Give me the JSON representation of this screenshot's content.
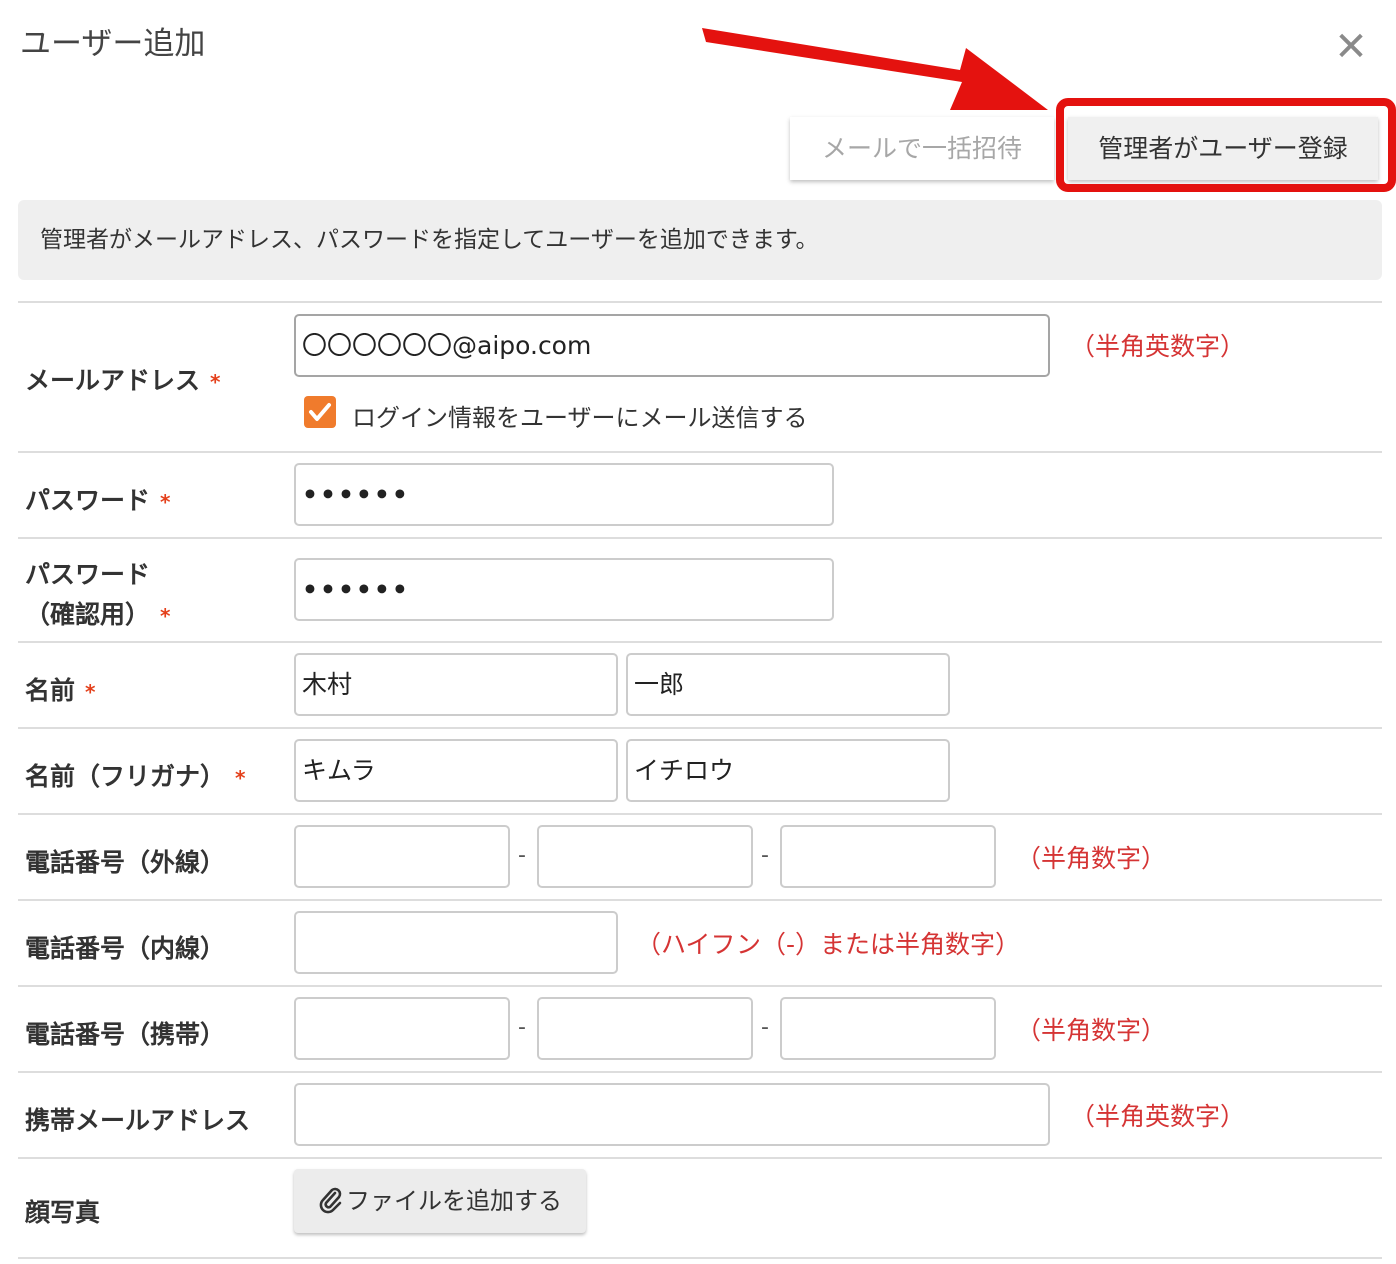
{
  "dialog": {
    "title": "ユーザー追加",
    "close_symbol": "✕"
  },
  "tabs": {
    "invite_label": "メールで一括招待",
    "register_label": "管理者がユーザー登録"
  },
  "info_text": "管理者がメールアドレス、パスワードを指定してユーザーを追加できます。",
  "required_mark": "*",
  "fields": {
    "email": {
      "label": "メールアドレス",
      "value": "〇〇〇〇〇〇@aipo.com",
      "hint": "（半角英数字）",
      "send_login_label": "ログイン情報をユーザーにメール送信する"
    },
    "password": {
      "label": "パスワード",
      "value": "••••••"
    },
    "password_confirm": {
      "label_line1": "パスワード",
      "label_line2": "（確認用）",
      "value": "••••••"
    },
    "name": {
      "label": "名前",
      "last": "木村",
      "first": "一郎"
    },
    "name_kana": {
      "label": "名前（フリガナ）",
      "last": "キムラ",
      "first": "イチロウ"
    },
    "phone_outside": {
      "label": "電話番号（外線）",
      "hint": "（半角数字）",
      "separator": "-"
    },
    "phone_extension": {
      "label": "電話番号（内線）",
      "hint": "（ハイフン（-）または半角数字）"
    },
    "phone_mobile": {
      "label": "電話番号（携帯）",
      "hint": "（半角数字）",
      "separator": "-"
    },
    "mobile_email": {
      "label": "携帯メールアドレス",
      "hint": "（半角英数字）"
    },
    "photo": {
      "label": "顔写真",
      "button_label": "ファイルを追加する"
    }
  },
  "colors": {
    "highlight": "#e4120f",
    "required": "#e4401b",
    "hint": "#d53434",
    "checkbox": "#f07b2c"
  },
  "icons": {
    "close": "close-icon",
    "checkbox": "check-icon",
    "attach": "paperclip-icon",
    "annotation": "arrow-annotation"
  }
}
